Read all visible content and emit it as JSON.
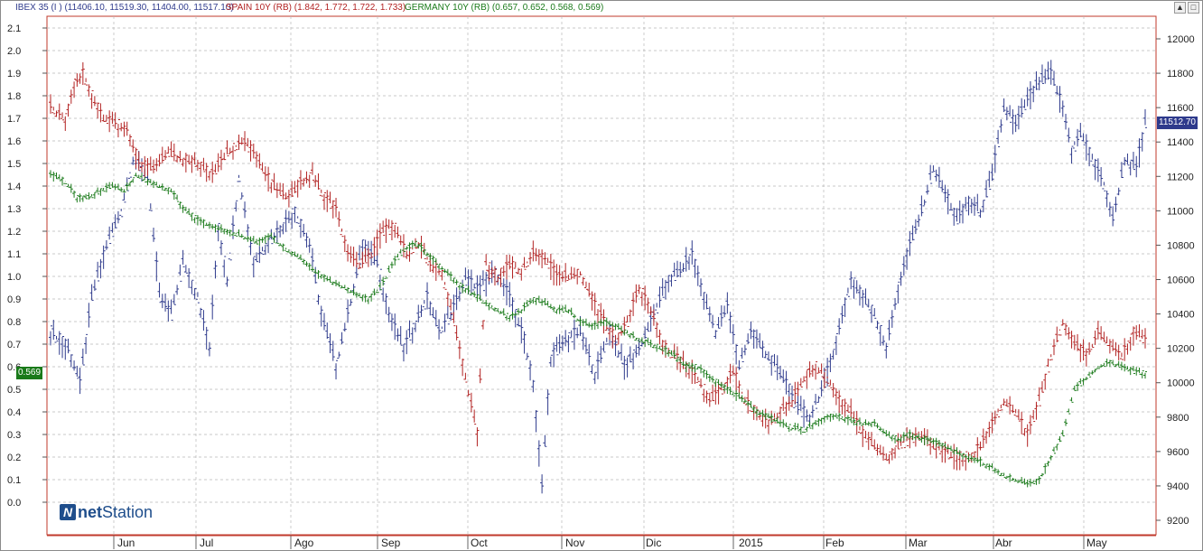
{
  "header": {
    "ibex_label": "IBEX 35 (I ) (11406.10, 11519.30, 11404.00, 11517.10)",
    "spain_label": "SPAIN 10Y (RB) (1.842, 1.772, 1.722, 1.733)",
    "germany_label": "GERMANY 10Y (RB) (0.657, 0.652, 0.568, 0.569)",
    "window_buttons": [
      "▲",
      "□"
    ]
  },
  "logo": {
    "mark": "N",
    "text_bold": "net",
    "text_regular": "Station"
  },
  "colors": {
    "ibex": "#2e3a8c",
    "spain": "#b22222",
    "germany": "#1a7a1a",
    "grid": "#b8b8b8",
    "axis": "#c0392b"
  },
  "chart_data": {
    "type": "ohlc",
    "title": "",
    "left_axis": {
      "ticks": [
        "2.1",
        "2.0",
        "1.9",
        "1.8",
        "1.7",
        "1.6",
        "1.5",
        "1.4",
        "1.3",
        "1.2",
        "1.1",
        "1.0",
        "0.9",
        "0.8",
        "0.7",
        "0.6",
        "0.5",
        "0.4",
        "0.3",
        "0.2",
        "0.1",
        "0.0"
      ],
      "range": [
        -0.1,
        2.1
      ]
    },
    "right_axis": {
      "ticks": [
        "12000",
        "11800",
        "11600",
        "11400",
        "11200",
        "11000",
        "10800",
        "10600",
        "10400",
        "10200",
        "10000",
        "9800",
        "9600",
        "9400",
        "9200"
      ],
      "range": [
        9200,
        12050
      ]
    },
    "x_labels": [
      "Jun",
      "Jul",
      "Ago",
      "Sep",
      "Oct",
      "Nov",
      "Dic",
      "2015",
      "Feb",
      "Mar",
      "Abr",
      "May"
    ],
    "last_values": {
      "germany": "0.569",
      "ibex": "11512.70"
    },
    "series": [
      {
        "name": "IBEX 35 (I )",
        "axis": "right",
        "points": [
          [
            0,
            10300
          ],
          [
            6,
            10200
          ],
          [
            10,
            10000
          ],
          [
            14,
            10500
          ],
          [
            19,
            10800
          ],
          [
            24,
            11000
          ],
          [
            28,
            11300
          ],
          [
            33,
            11200
          ],
          [
            37,
            10500
          ],
          [
            41,
            10400
          ],
          [
            45,
            10700
          ],
          [
            50,
            10500
          ],
          [
            54,
            10200
          ],
          [
            57,
            10900
          ],
          [
            60,
            10600
          ],
          [
            64,
            11200
          ],
          [
            69,
            10700
          ],
          [
            73,
            10800
          ],
          [
            78,
            10900
          ],
          [
            83,
            11000
          ],
          [
            88,
            10800
          ],
          [
            92,
            10400
          ],
          [
            97,
            10100
          ],
          [
            101,
            10400
          ],
          [
            106,
            10800
          ],
          [
            111,
            10700
          ],
          [
            115,
            10400
          ],
          [
            120,
            10200
          ],
          [
            124,
            10350
          ],
          [
            128,
            10500
          ],
          [
            132,
            10300
          ],
          [
            136,
            10400
          ],
          [
            141,
            10600
          ],
          [
            146,
            10550
          ],
          [
            151,
            10650
          ],
          [
            156,
            10500
          ],
          [
            161,
            10250
          ],
          [
            164,
            10000
          ],
          [
            167,
            9400
          ],
          [
            170,
            10150
          ],
          [
            175,
            10250
          ],
          [
            180,
            10300
          ],
          [
            185,
            10050
          ],
          [
            190,
            10300
          ],
          [
            195,
            10100
          ],
          [
            200,
            10200
          ],
          [
            205,
            10400
          ],
          [
            210,
            10600
          ],
          [
            214,
            10650
          ],
          [
            218,
            10750
          ],
          [
            222,
            10500
          ],
          [
            226,
            10300
          ],
          [
            230,
            10450
          ],
          [
            234,
            10100
          ],
          [
            238,
            10300
          ],
          [
            242,
            10200
          ],
          [
            246,
            10100
          ],
          [
            250,
            10000
          ],
          [
            254,
            9850
          ],
          [
            258,
            9800
          ],
          [
            263,
            10000
          ],
          [
            267,
            10250
          ],
          [
            272,
            10600
          ],
          [
            276,
            10500
          ],
          [
            280,
            10400
          ],
          [
            284,
            10200
          ],
          [
            288,
            10550
          ],
          [
            292,
            10800
          ],
          [
            296,
            11000
          ],
          [
            300,
            11250
          ],
          [
            304,
            11100
          ],
          [
            308,
            10950
          ],
          [
            312,
            11050
          ],
          [
            316,
            11000
          ],
          [
            320,
            11200
          ],
          [
            324,
            11600
          ],
          [
            328,
            11500
          ],
          [
            332,
            11650
          ],
          [
            336,
            11750
          ],
          [
            340,
            11800
          ],
          [
            344,
            11600
          ],
          [
            347,
            11350
          ],
          [
            350,
            11450
          ],
          [
            354,
            11300
          ],
          [
            358,
            11150
          ],
          [
            361,
            10950
          ],
          [
            365,
            11300
          ],
          [
            369,
            11250
          ],
          [
            372,
            11510
          ]
        ]
      },
      {
        "name": "SPAIN 10Y (RB)",
        "axis": "left",
        "points": [
          [
            0,
            1.75
          ],
          [
            5,
            1.7
          ],
          [
            8,
            1.85
          ],
          [
            11,
            1.9
          ],
          [
            14,
            1.8
          ],
          [
            18,
            1.7
          ],
          [
            22,
            1.68
          ],
          [
            26,
            1.65
          ],
          [
            30,
            1.5
          ],
          [
            35,
            1.48
          ],
          [
            40,
            1.55
          ],
          [
            45,
            1.52
          ],
          [
            50,
            1.5
          ],
          [
            55,
            1.45
          ],
          [
            60,
            1.55
          ],
          [
            65,
            1.6
          ],
          [
            69,
            1.55
          ],
          [
            73,
            1.45
          ],
          [
            77,
            1.38
          ],
          [
            81,
            1.35
          ],
          [
            85,
            1.42
          ],
          [
            89,
            1.45
          ],
          [
            93,
            1.35
          ],
          [
            97,
            1.3
          ],
          [
            101,
            1.1
          ],
          [
            105,
            1.05
          ],
          [
            109,
            1.1
          ],
          [
            113,
            1.2
          ],
          [
            117,
            1.22
          ],
          [
            121,
            1.1
          ],
          [
            125,
            1.15
          ],
          [
            129,
            1.05
          ],
          [
            133,
            1.02
          ],
          [
            137,
            0.8
          ],
          [
            141,
            0.55
          ],
          [
            145,
            0.3
          ],
          [
            148,
            1.05
          ],
          [
            152,
            1.0
          ],
          [
            156,
            1.05
          ],
          [
            160,
            1.03
          ],
          [
            164,
            1.1
          ],
          [
            168,
            1.08
          ],
          [
            172,
            1.0
          ],
          [
            176,
            1.0
          ],
          [
            180,
            1.02
          ],
          [
            184,
            0.9
          ],
          [
            188,
            0.8
          ],
          [
            192,
            0.72
          ],
          [
            196,
            0.8
          ],
          [
            200,
            0.95
          ],
          [
            204,
            0.85
          ],
          [
            208,
            0.7
          ],
          [
            212,
            0.65
          ],
          [
            216,
            0.6
          ],
          [
            220,
            0.55
          ],
          [
            224,
            0.45
          ],
          [
            228,
            0.5
          ],
          [
            232,
            0.58
          ],
          [
            236,
            0.45
          ],
          [
            240,
            0.4
          ],
          [
            244,
            0.35
          ],
          [
            248,
            0.4
          ],
          [
            252,
            0.45
          ],
          [
            256,
            0.55
          ],
          [
            260,
            0.6
          ],
          [
            264,
            0.55
          ],
          [
            268,
            0.45
          ],
          [
            272,
            0.4
          ],
          [
            276,
            0.3
          ],
          [
            280,
            0.25
          ],
          [
            284,
            0.2
          ],
          [
            288,
            0.25
          ],
          [
            292,
            0.28
          ],
          [
            296,
            0.3
          ],
          [
            300,
            0.25
          ],
          [
            304,
            0.22
          ],
          [
            308,
            0.2
          ],
          [
            312,
            0.2
          ],
          [
            316,
            0.25
          ],
          [
            320,
            0.35
          ],
          [
            324,
            0.45
          ],
          [
            328,
            0.4
          ],
          [
            332,
            0.3
          ],
          [
            336,
            0.45
          ],
          [
            340,
            0.65
          ],
          [
            344,
            0.8
          ],
          [
            348,
            0.7
          ],
          [
            352,
            0.65
          ],
          [
            356,
            0.75
          ],
          [
            360,
            0.7
          ],
          [
            364,
            0.65
          ],
          [
            368,
            0.75
          ],
          [
            372,
            0.72
          ]
        ]
      },
      {
        "name": "GERMANY 10Y (RB)",
        "axis": "left",
        "points": [
          [
            0,
            1.45
          ],
          [
            5,
            1.42
          ],
          [
            9,
            1.35
          ],
          [
            13,
            1.35
          ],
          [
            17,
            1.38
          ],
          [
            21,
            1.4
          ],
          [
            25,
            1.38
          ],
          [
            29,
            1.45
          ],
          [
            33,
            1.42
          ],
          [
            37,
            1.4
          ],
          [
            41,
            1.38
          ],
          [
            45,
            1.3
          ],
          [
            50,
            1.25
          ],
          [
            55,
            1.22
          ],
          [
            60,
            1.2
          ],
          [
            65,
            1.18
          ],
          [
            70,
            1.15
          ],
          [
            75,
            1.18
          ],
          [
            80,
            1.12
          ],
          [
            85,
            1.08
          ],
          [
            90,
            1.02
          ],
          [
            95,
            0.98
          ],
          [
            100,
            0.95
          ],
          [
            104,
            0.92
          ],
          [
            108,
            0.9
          ],
          [
            112,
            0.95
          ],
          [
            116,
            1.05
          ],
          [
            120,
            1.12
          ],
          [
            124,
            1.15
          ],
          [
            128,
            1.1
          ],
          [
            132,
            1.05
          ],
          [
            136,
            1.0
          ],
          [
            140,
            0.95
          ],
          [
            144,
            0.92
          ],
          [
            148,
            0.88
          ],
          [
            152,
            0.85
          ],
          [
            156,
            0.82
          ],
          [
            160,
            0.85
          ],
          [
            164,
            0.9
          ],
          [
            168,
            0.88
          ],
          [
            172,
            0.85
          ],
          [
            176,
            0.85
          ],
          [
            180,
            0.8
          ],
          [
            184,
            0.78
          ],
          [
            188,
            0.8
          ],
          [
            192,
            0.78
          ],
          [
            196,
            0.75
          ],
          [
            200,
            0.72
          ],
          [
            204,
            0.7
          ],
          [
            208,
            0.68
          ],
          [
            212,
            0.65
          ],
          [
            216,
            0.6
          ],
          [
            220,
            0.6
          ],
          [
            224,
            0.55
          ],
          [
            228,
            0.52
          ],
          [
            232,
            0.48
          ],
          [
            236,
            0.45
          ],
          [
            240,
            0.4
          ],
          [
            244,
            0.38
          ],
          [
            248,
            0.35
          ],
          [
            252,
            0.33
          ],
          [
            256,
            0.32
          ],
          [
            260,
            0.35
          ],
          [
            264,
            0.38
          ],
          [
            268,
            0.38
          ],
          [
            272,
            0.36
          ],
          [
            276,
            0.35
          ],
          [
            280,
            0.35
          ],
          [
            284,
            0.3
          ],
          [
            288,
            0.28
          ],
          [
            292,
            0.3
          ],
          [
            296,
            0.28
          ],
          [
            300,
            0.27
          ],
          [
            304,
            0.25
          ],
          [
            308,
            0.22
          ],
          [
            312,
            0.2
          ],
          [
            316,
            0.18
          ],
          [
            320,
            0.15
          ],
          [
            324,
            0.12
          ],
          [
            328,
            0.1
          ],
          [
            332,
            0.08
          ],
          [
            336,
            0.1
          ],
          [
            340,
            0.2
          ],
          [
            344,
            0.3
          ],
          [
            348,
            0.5
          ],
          [
            352,
            0.55
          ],
          [
            356,
            0.6
          ],
          [
            360,
            0.62
          ],
          [
            364,
            0.6
          ],
          [
            368,
            0.58
          ],
          [
            372,
            0.57
          ]
        ]
      }
    ]
  }
}
